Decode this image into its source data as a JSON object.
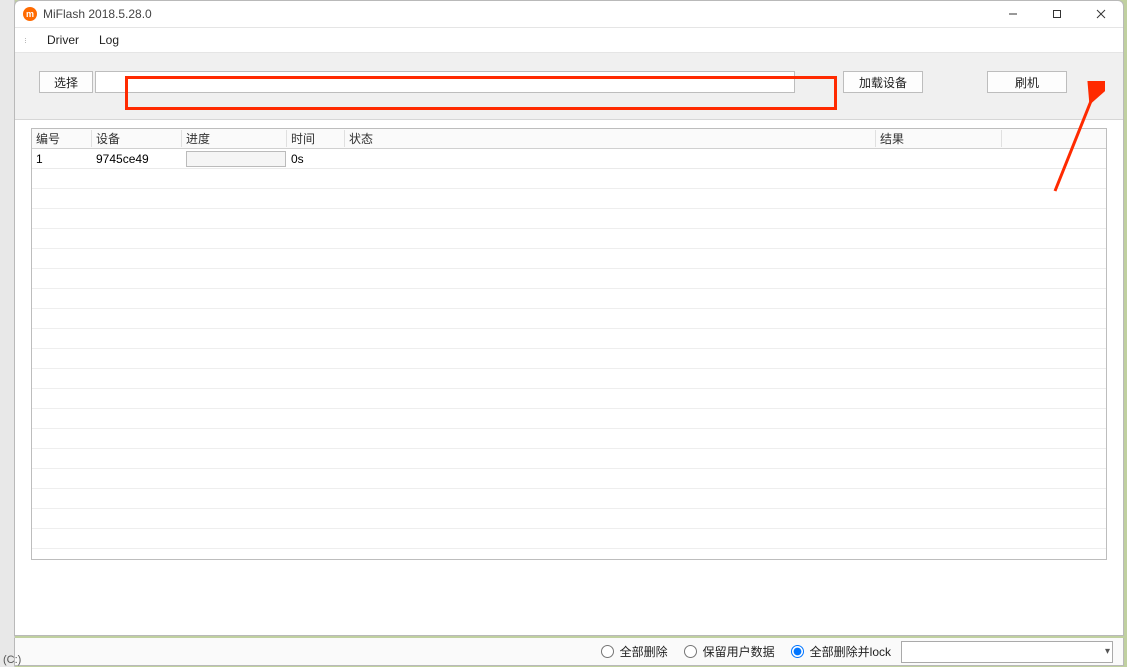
{
  "window": {
    "title": "MiFlash 2018.5.28.0"
  },
  "menu": {
    "driver": "Driver",
    "log": "Log"
  },
  "toolbar": {
    "select_label": "选择",
    "path_value": "",
    "load_devices_label": "加载设备",
    "flash_label": "刷机"
  },
  "grid": {
    "headers": {
      "id": "编号",
      "device": "设备",
      "progress": "进度",
      "time": "时间",
      "status": "状态",
      "result": "结果"
    },
    "rows": [
      {
        "id": "1",
        "device": "9745ce49",
        "progress": "",
        "time": "0s",
        "status": "",
        "result": ""
      }
    ]
  },
  "bottom": {
    "opt_clean_all": "全部删除",
    "opt_save_user": "保留用户数据",
    "opt_clean_lock": "全部删除并lock",
    "selected": "opt_clean_lock",
    "combo_value": ""
  },
  "bg": {
    "disk_label": "(C:)"
  }
}
